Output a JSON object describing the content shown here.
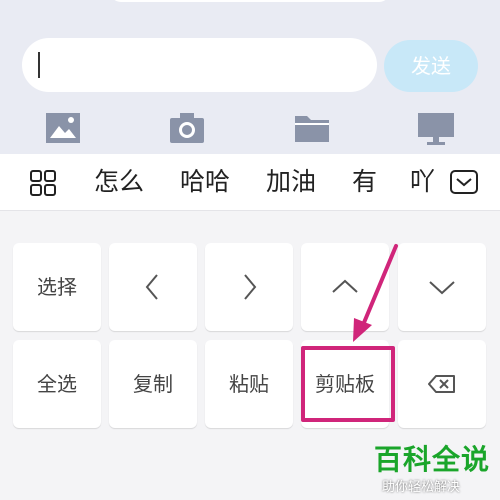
{
  "composer": {
    "send_label": "发送"
  },
  "candidates": [
    "怎么",
    "哈哈",
    "加油",
    "有",
    "吖"
  ],
  "keys": {
    "select": "选择",
    "select_all": "全选",
    "copy": "复制",
    "paste": "粘贴",
    "clipboard": "剪贴板"
  },
  "watermark": {
    "title": "百科全说",
    "subtitle": "助你轻松解决"
  },
  "colors": {
    "send_button": "#c8e8f8",
    "highlight": "#d0257a",
    "watermark_green": "#1aa52a",
    "tool_icons": "#8a93a8"
  },
  "icons": [
    "image-icon",
    "camera-icon",
    "folder-icon",
    "monitor-icon",
    "grid-icon",
    "keyboard-hide-icon",
    "backspace-icon"
  ]
}
